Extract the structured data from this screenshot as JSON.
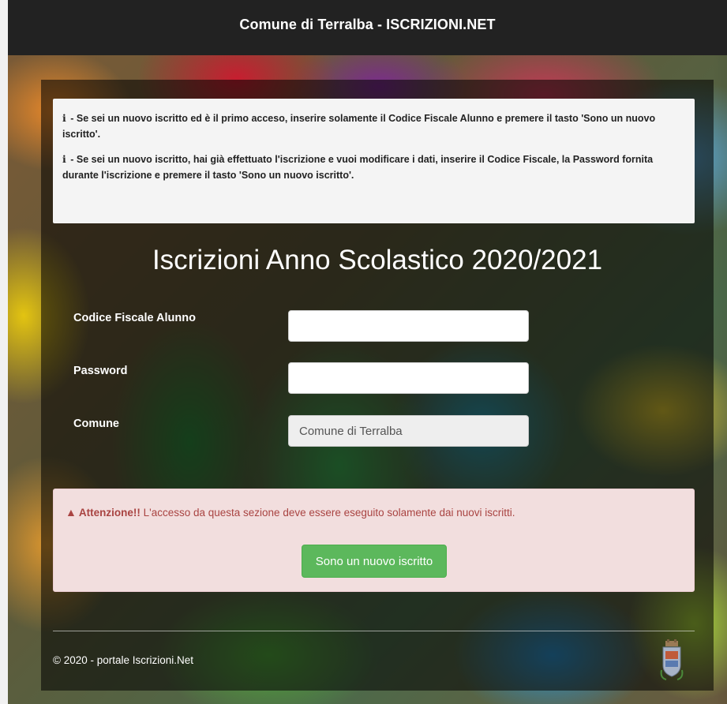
{
  "header": {
    "title": "Comune di Terralba - ISCRIZIONI.NET"
  },
  "info": {
    "icon": "info-icon",
    "icon_glyph": "i",
    "line1": "- Se sei un nuovo iscritto ed è il primo acceso, inserire solamente il Codice Fiscale Alunno e premere il tasto 'Sono un nuovo iscritto'.",
    "line2": "- Se sei un nuovo iscritto, hai già effettuato l'iscrizione e vuoi modificare i dati, inserire il Codice Fiscale, la Password fornita durante l'iscrizione e premere il tasto 'Sono un nuovo iscritto'."
  },
  "form": {
    "title": "Iscrizioni Anno Scolastico 2020/2021",
    "codice_fiscale": {
      "label": "Codice Fiscale Alunno",
      "value": ""
    },
    "password": {
      "label": "Password",
      "value": ""
    },
    "comune": {
      "label": "Comune",
      "value": "Comune di Terralba"
    }
  },
  "alert": {
    "icon": "warning-icon",
    "icon_glyph": "▲",
    "strong": "Attenzione!!",
    "text": "L'accesso da questa sezione deve essere eseguito solamente dai nuovi iscritti.",
    "button_label": "Sono un nuovo iscritto",
    "button_color": "#5cb85c"
  },
  "footer": {
    "copyright": "© 2020 - portale Iscrizioni.Net",
    "logo": "municipality-crest-icon"
  }
}
